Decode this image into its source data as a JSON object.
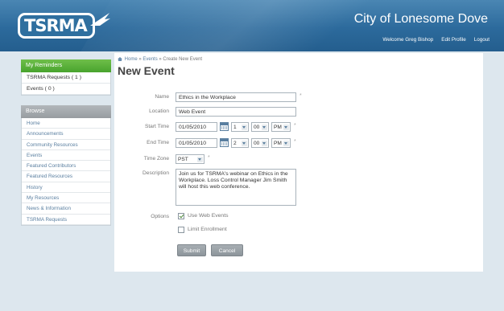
{
  "header": {
    "logo_text": "TSRMA",
    "site_title": "City of Lonesome Dove",
    "welcome": "Welcome Greg Bishop",
    "edit_profile": "Edit Profile",
    "logout": "Logout"
  },
  "reminders": {
    "title": "My Reminders",
    "items": [
      {
        "label": "TSRMA Requests ( 1 )"
      },
      {
        "label": "Events ( 0 )"
      }
    ]
  },
  "browse": {
    "title": "Browse",
    "items": [
      {
        "label": "Home"
      },
      {
        "label": "Announcements"
      },
      {
        "label": "Community Resources"
      },
      {
        "label": "Events"
      },
      {
        "label": "Featured Contributors"
      },
      {
        "label": "Featured Resources"
      },
      {
        "label": "History"
      },
      {
        "label": "My Resources"
      },
      {
        "label": "News & Information"
      },
      {
        "label": "TSRMA Requests"
      }
    ]
  },
  "breadcrumb": {
    "home": "Home",
    "events": "Events",
    "current": "Create New Event",
    "sep": "»"
  },
  "page_title": "New Event",
  "form": {
    "name_label": "Name",
    "name_value": "Ethics in the Workplace",
    "location_label": "Location",
    "location_value": "Web Event",
    "start_label": "Start Time",
    "start_date": "01/05/2010",
    "start_hour": "1",
    "start_min": "00",
    "start_ampm": "PM",
    "end_label": "End Time",
    "end_date": "01/05/2010",
    "end_hour": "2",
    "end_min": "00",
    "end_ampm": "PM",
    "tz_label": "Time Zone",
    "tz_value": "PST",
    "desc_label": "Description",
    "desc_value": "Join us for TSRMA's webinar on Ethics in the Workplace.  Loss Control Manager Jim Smith will host this web conference.",
    "options_label": "Options",
    "use_web_events": {
      "label": "Use Web Events",
      "checked": true
    },
    "limit_enrollment": {
      "label": "Limit Enrollment",
      "checked": false
    },
    "required_mark": "*"
  },
  "buttons": {
    "submit": "Submit",
    "cancel": "Cancel"
  },
  "colors": {
    "header": "#2c6a9c",
    "reminder_head": "#48a32d",
    "browse_head": "#979ca0",
    "link": "#5a7fa0"
  }
}
